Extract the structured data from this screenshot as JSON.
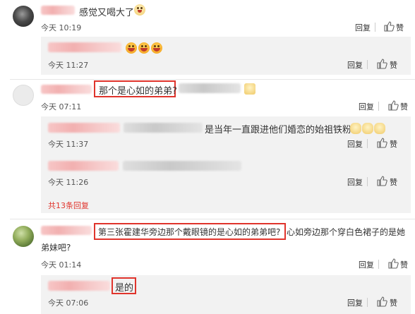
{
  "comments": [
    {
      "text": "感觉又喝大了",
      "time": "今天 10:19",
      "reply_label": "回复",
      "like_label": "赞",
      "replies": [
        {
          "time": "今天 11:27",
          "reply_label": "回复",
          "like_label": "赞"
        }
      ]
    },
    {
      "text": "那个是心如的弟弟?",
      "time": "今天 07:11",
      "reply_label": "回复",
      "like_label": "赞",
      "replies": [
        {
          "text": "是当年一直跟进他们婚恋的始祖铁粉吗",
          "time": "今天 11:37",
          "reply_label": "回复",
          "like_label": "赞"
        },
        {
          "time": "今天 11:26",
          "reply_label": "回复",
          "like_label": "赞"
        }
      ],
      "more_replies": "共13条回复"
    },
    {
      "text_highlight": "第三张霍建华旁边那个戴眼镜的是心如的弟弟吧?",
      "text_rest_line1": "心如旁边那个穿白色裙子的是她",
      "text_line2": "弟妹吧?",
      "time": "今天 01:14",
      "reply_label": "回复",
      "like_label": "赞",
      "replies": [
        {
          "text": "是的",
          "time": "今天 07:06",
          "reply_label": "回复",
          "like_label": "赞"
        }
      ]
    }
  ],
  "icons": {
    "reply_icon": "reply-arrow-icon",
    "like_icon": "thumbs-up-icon"
  },
  "colors": {
    "highlight": "#e0342c",
    "reply_bg": "#f2f2f2",
    "more_link": "#e0342c"
  }
}
